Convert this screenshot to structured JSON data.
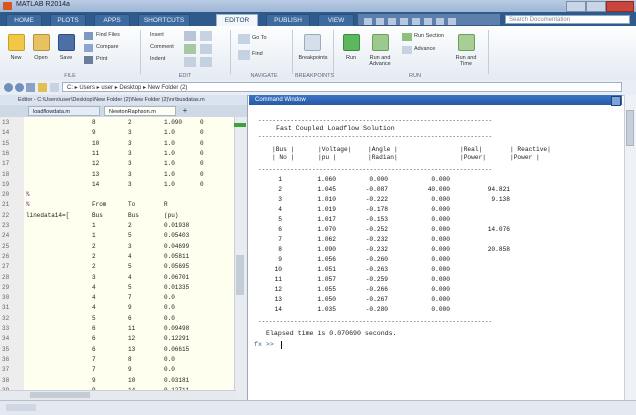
{
  "window": {
    "title": "MATLAB R2014a"
  },
  "tabs": [
    {
      "label": "HOME"
    },
    {
      "label": "PLOTS"
    },
    {
      "label": "APPS"
    },
    {
      "label": "SHORTCUTS"
    },
    {
      "label": "EDITOR"
    },
    {
      "label": "PUBLISH"
    },
    {
      "label": "VIEW"
    }
  ],
  "search": {
    "placeholder": "Search Documentation"
  },
  "ribbon": {
    "file": [
      {
        "label": "New"
      },
      {
        "label": "Open"
      },
      {
        "label": "Save"
      }
    ],
    "find_files": "Find Files",
    "compare": "Compare",
    "print": "Print",
    "insert": "Insert",
    "comment": "Comment",
    "indent": "Indent",
    "goto": "Go To",
    "find": "Find",
    "breakpoints": "Breakpoints",
    "run": "Run",
    "run_and_advance": "Run and Advance",
    "run_section": "Run Section",
    "advance": "Advance",
    "run_and_time": "Run and Time",
    "groups": [
      "FILE",
      "EDIT",
      "NAVIGATE",
      "BREAKPOINTS",
      "RUN"
    ]
  },
  "address": {
    "path": "C: ▸ Users ▸ user ▸ Desktop ▸ New Folder (2)"
  },
  "editor": {
    "header": "Editor - C:\\Users\\user\\Desktop\\New Folder (2)\\New Folder (2)\\nr\\busdatas.m",
    "tabs": [
      {
        "label": "loadflowdata.m"
      },
      {
        "label": "NewtonRaphson.m"
      }
    ],
    "rows": [
      {
        "ln": "13",
        "c0": "",
        "c1": "8",
        "c2": "2",
        "c3": "1.090",
        "c4": "0"
      },
      {
        "ln": "14",
        "c0": "",
        "c1": "9",
        "c2": "3",
        "c3": "1.0",
        "c4": "0"
      },
      {
        "ln": "15",
        "c0": "",
        "c1": "10",
        "c2": "3",
        "c3": "1.0",
        "c4": "0"
      },
      {
        "ln": "16",
        "c0": "",
        "c1": "11",
        "c2": "3",
        "c3": "1.0",
        "c4": "0"
      },
      {
        "ln": "17",
        "c0": "",
        "c1": "12",
        "c2": "3",
        "c3": "1.0",
        "c4": "0"
      },
      {
        "ln": "18",
        "c0": "",
        "c1": "13",
        "c2": "3",
        "c3": "1.0",
        "c4": "0"
      },
      {
        "ln": "19",
        "c0": "",
        "c1": "14",
        "c2": "3",
        "c3": "1.0",
        "c4": "0"
      },
      {
        "ln": "20",
        "c0": "%",
        "c1": "",
        "c2": "",
        "c3": "",
        "c4": ""
      },
      {
        "ln": "21",
        "c0": "%",
        "c1": "From",
        "c2": "To",
        "c3": "R",
        "c4": ""
      },
      {
        "ln": "22",
        "c0": "linedata14=[",
        "c1": "Bus",
        "c2": "Bus",
        "c3": "(pu)",
        "c4": ""
      },
      {
        "ln": "23",
        "c0": "",
        "c1": "1",
        "c2": "2",
        "c3": "0.01938",
        "c4": ""
      },
      {
        "ln": "24",
        "c0": "",
        "c1": "1",
        "c2": "5",
        "c3": "0.05403",
        "c4": ""
      },
      {
        "ln": "25",
        "c0": "",
        "c1": "2",
        "c2": "3",
        "c3": "0.04699",
        "c4": ""
      },
      {
        "ln": "26",
        "c0": "",
        "c1": "2",
        "c2": "4",
        "c3": "0.05811",
        "c4": ""
      },
      {
        "ln": "27",
        "c0": "",
        "c1": "2",
        "c2": "5",
        "c3": "0.05695",
        "c4": ""
      },
      {
        "ln": "28",
        "c0": "",
        "c1": "3",
        "c2": "4",
        "c3": "0.06701",
        "c4": ""
      },
      {
        "ln": "29",
        "c0": "",
        "c1": "4",
        "c2": "5",
        "c3": "0.01335",
        "c4": ""
      },
      {
        "ln": "30",
        "c0": "",
        "c1": "4",
        "c2": "7",
        "c3": "0.0",
        "c4": ""
      },
      {
        "ln": "31",
        "c0": "",
        "c1": "4",
        "c2": "9",
        "c3": "0.0",
        "c4": ""
      },
      {
        "ln": "32",
        "c0": "",
        "c1": "5",
        "c2": "6",
        "c3": "0.0",
        "c4": ""
      },
      {
        "ln": "33",
        "c0": "",
        "c1": "6",
        "c2": "11",
        "c3": "0.09498",
        "c4": ""
      },
      {
        "ln": "34",
        "c0": "",
        "c1": "6",
        "c2": "12",
        "c3": "0.12291",
        "c4": ""
      },
      {
        "ln": "35",
        "c0": "",
        "c1": "6",
        "c2": "13",
        "c3": "0.06615",
        "c4": ""
      },
      {
        "ln": "36",
        "c0": "",
        "c1": "7",
        "c2": "8",
        "c3": "0.0",
        "c4": ""
      },
      {
        "ln": "37",
        "c0": "",
        "c1": "7",
        "c2": "9",
        "c3": "0.0",
        "c4": ""
      },
      {
        "ln": "38",
        "c0": "",
        "c1": "9",
        "c2": "10",
        "c3": "0.03181",
        "c4": ""
      },
      {
        "ln": "39",
        "c0": "",
        "c1": "9",
        "c2": "14",
        "c3": "0.12711",
        "c4": ""
      }
    ]
  },
  "command_window": {
    "title": "Command Window",
    "separator": "-----------------------------------------------------------------",
    "heading": "Fast Coupled Loadflow Solution",
    "header_row1": [
      "|Bus |",
      "|Voltage|",
      "|Angle |",
      "|Real|",
      "| Reactive|"
    ],
    "header_row2": [
      "| No |",
      "|pu |",
      "|Radian|",
      "|Power|",
      "|Power |"
    ],
    "rows": [
      {
        "bus": "1",
        "v": "1.060",
        "a": "0.000",
        "p": "0.000",
        "q": ""
      },
      {
        "bus": "2",
        "v": "1.045",
        "a": "-0.087",
        "p": "40.000",
        "q": "94.821"
      },
      {
        "bus": "3",
        "v": "1.010",
        "a": "-0.222",
        "p": "0.000",
        "q": "9.138"
      },
      {
        "bus": "4",
        "v": "1.019",
        "a": "-0.178",
        "p": "0.000",
        "q": ""
      },
      {
        "bus": "5",
        "v": "1.017",
        "a": "-0.153",
        "p": "0.000",
        "q": ""
      },
      {
        "bus": "6",
        "v": "1.070",
        "a": "-0.252",
        "p": "0.000",
        "q": "14.076"
      },
      {
        "bus": "7",
        "v": "1.062",
        "a": "-0.232",
        "p": "0.000",
        "q": ""
      },
      {
        "bus": "8",
        "v": "1.090",
        "a": "-0.232",
        "p": "0.000",
        "q": "20.858"
      },
      {
        "bus": "9",
        "v": "1.056",
        "a": "-0.260",
        "p": "0.000",
        "q": ""
      },
      {
        "bus": "10",
        "v": "1.051",
        "a": "-0.263",
        "p": "0.000",
        "q": ""
      },
      {
        "bus": "11",
        "v": "1.057",
        "a": "-0.259",
        "p": "0.000",
        "q": ""
      },
      {
        "bus": "12",
        "v": "1.055",
        "a": "-0.266",
        "p": "0.000",
        "q": ""
      },
      {
        "bus": "13",
        "v": "1.050",
        "a": "-0.267",
        "p": "0.000",
        "q": ""
      },
      {
        "bus": "14",
        "v": "1.035",
        "a": "-0.280",
        "p": "0.000",
        "q": ""
      }
    ],
    "elapsed": "Elapsed time is 0.070690 seconds.",
    "prompt": "fx >>"
  }
}
